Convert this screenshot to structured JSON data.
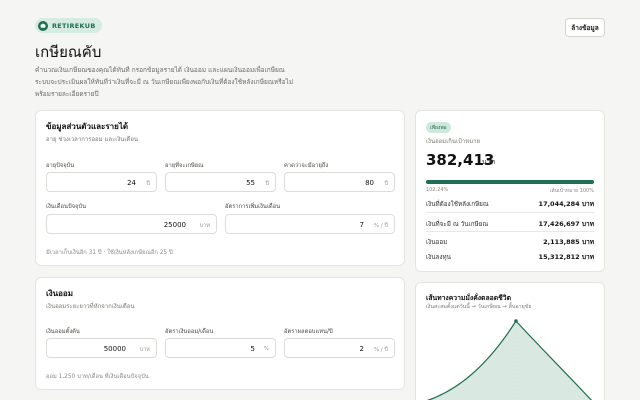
{
  "brand": {
    "name": "RETIREKUB",
    "icon": "piggy-bank-icon"
  },
  "header": {
    "clear_label": "ล้างข้อมูล"
  },
  "page": {
    "title": "เกษียณคับ",
    "description": "คำนวณเงินเกษียณของคุณได้ทันที กรอกข้อมูลรายได้ เงินออม และแผนเงินออมเพื่อเกษียณ ระบบจะประเมินผลให้ทันทีว่าเงินที่จะมี ณ วันเกษียณเพียงพอกับเงินที่ต้องใช้หลังเกษียณหรือไม่ พร้อมรายละเอียดรายปี"
  },
  "personal": {
    "title": "ข้อมูลส่วนตัวและรายได้",
    "subtitle": "อายุ ช่วงเวลาการออม และเงินเดือน",
    "current_age": {
      "label": "อายุปัจจุบัน",
      "value": "24",
      "unit": "ปี"
    },
    "retire_age": {
      "label": "อายุที่จะเกษียณ",
      "value": "55",
      "unit": "ปี"
    },
    "life_expectancy": {
      "label": "คาดว่าจะมีอายุถึง",
      "value": "80",
      "unit": "ปี"
    },
    "salary": {
      "label": "เงินเดือนปัจจุบัน",
      "value": "25000",
      "unit": "บาท"
    },
    "salary_growth": {
      "label": "อัตราการเพิ่มเงินเดือน",
      "value": "7",
      "unit": "% / ปี"
    },
    "note": "มีเวลาเก็บเงินอีก 31 ปี · ใช้เงินหลังเกษียณอีก 25 ปี"
  },
  "savings": {
    "title": "เงินออม",
    "subtitle": "เงินออมระยะยาวที่หักจากเงินเดือน",
    "initial": {
      "label": "เงินออมตั้งต้น",
      "value": "50000",
      "unit": "บาท"
    },
    "rate": {
      "label": "อัตราเงินออม/เดือน",
      "value": "5",
      "unit": "%"
    },
    "return_rate": {
      "label": "อัตราผลตอบแทน/ปี",
      "value": "2",
      "unit": "% / ปี"
    },
    "note": "ออม 1,250 บาท/เดือน ที่เงินเดือนปัจจุบัน"
  },
  "summary": {
    "badge": "เพียงพอ",
    "label": "เงินออมเกินเป้าหมาย",
    "surplus": "382,413",
    "unit": "บาท",
    "progress_percent": 102.24,
    "progress_left": "102.24%",
    "progress_right": "เส้นเป้าหมาย 100%",
    "rows": [
      {
        "label": "เงินที่ต้องใช้หลังเกษียณ",
        "value": "17,044,284 บาท"
      },
      {
        "label": "เงินที่จะมี ณ วันเกษียณ",
        "value": "17,426,697 บาท"
      },
      {
        "label": "เงินออม",
        "value": "2,113,885 บาท"
      },
      {
        "label": "เงินลงทุน",
        "value": "15,312,812 บาท"
      }
    ]
  },
  "lifeline": {
    "title": "เส้นทางความมั่งคั่งตลอดชีวิต",
    "subtitle": "เงินสะสมตั้งแต่วันนี้ → วันเกษียณ → สิ้นอายุขัย"
  },
  "colors": {
    "accent": "#1f6e55",
    "badge_bg": "#cfe8db"
  }
}
